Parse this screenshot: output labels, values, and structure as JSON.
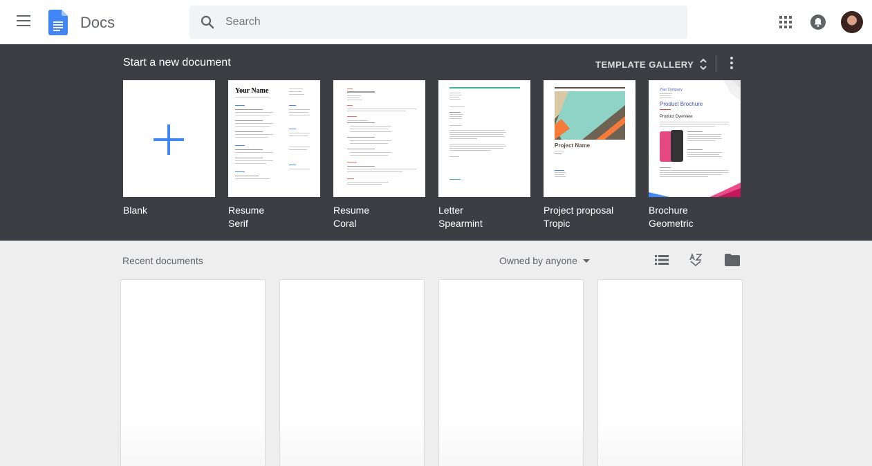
{
  "header": {
    "app_name": "Docs",
    "search_placeholder": "Search",
    "icons": [
      "menu-icon",
      "docs-logo-icon",
      "search-icon",
      "apps-grid-icon",
      "notifications-icon",
      "avatar"
    ]
  },
  "templates": {
    "section_title": "Start a new document",
    "gallery_label": "TEMPLATE GALLERY",
    "items": [
      {
        "name": "Blank",
        "sub": ""
      },
      {
        "name": "Resume",
        "sub": "Serif"
      },
      {
        "name": "Resume",
        "sub": "Coral"
      },
      {
        "name": "Letter",
        "sub": "Spearmint"
      },
      {
        "name": "Project proposal",
        "sub": "Tropic"
      },
      {
        "name": "Brochure",
        "sub": "Geometric"
      }
    ],
    "thumbnails": {
      "resume_serif_heading": "Your Name",
      "proposal_heading": "Project Name",
      "brochure_company": "Your Company",
      "brochure_title": "Product Brochure",
      "brochure_section": "Product Overview"
    }
  },
  "recent": {
    "title": "Recent documents",
    "owner_filter": "Owned by anyone",
    "documents": [
      {},
      {},
      {},
      {}
    ]
  },
  "colors": {
    "templates_bg": "#3c3e44",
    "docs_blue": "#4285f4",
    "page_bg": "#eeeeee"
  }
}
